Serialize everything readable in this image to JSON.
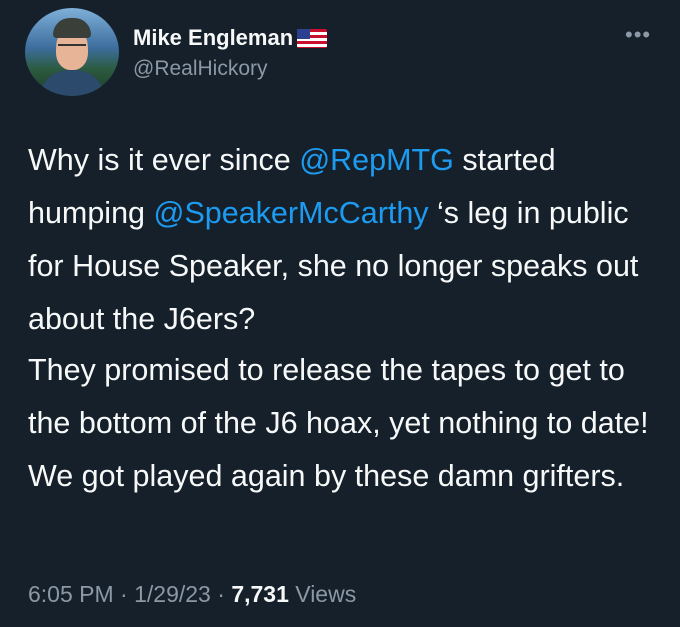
{
  "author": {
    "name": "Mike Engleman",
    "name_emoji_icon": "us-flag-icon",
    "handle": "@RealHickory",
    "avatar_icon": "profile-photo"
  },
  "menu_icon": "more-options-icon",
  "tweet": {
    "paragraph1": {
      "part1": "Why is it ever since ",
      "mention1": "@RepMTG",
      "part2": " started humping ",
      "mention2": "@SpeakerMcCarthy",
      "part3": " ‘s leg in public for House Speaker, she no longer speaks out about the J6ers?"
    },
    "paragraph2": "They promised to release the tapes to get to the bottom of the J6 hoax, yet nothing to date! We got played again by these damn grifters."
  },
  "footer": {
    "time": "6:05 PM",
    "separator": " · ",
    "date": "1/29/23",
    "views_count": "7,731",
    "views_label": " Views"
  },
  "colors": {
    "background": "#15202b",
    "text": "#f7f9f9",
    "secondary": "#8b98a5",
    "link": "#1d9bf0"
  }
}
